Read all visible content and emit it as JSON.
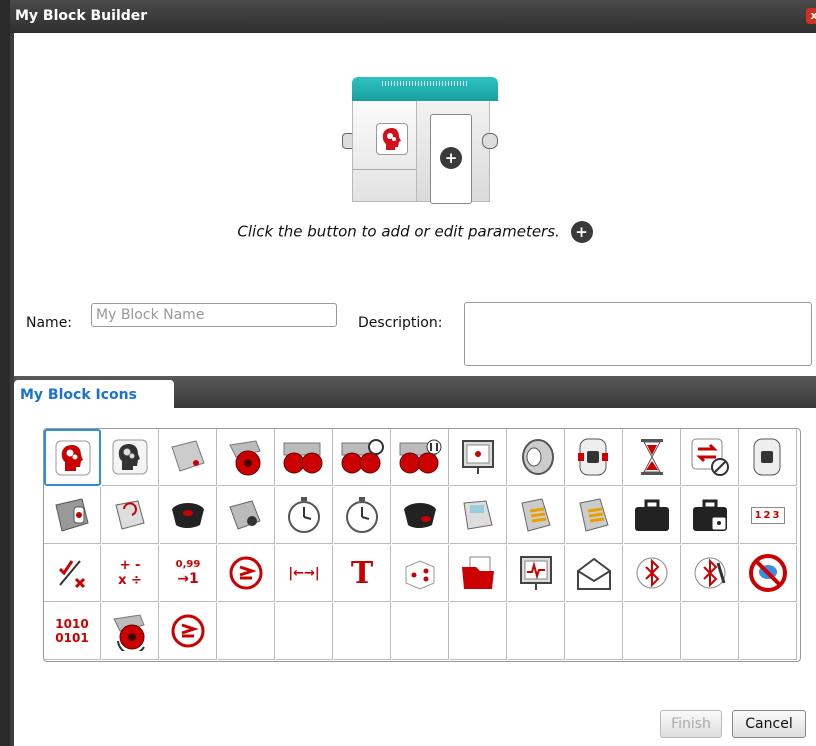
{
  "window": {
    "title": "My Block Builder",
    "close_glyph": "x"
  },
  "block_preview": {
    "add_glyph": "+"
  },
  "instruction": "Click the button to add or edit parameters.",
  "name_field": {
    "label": "Name:",
    "placeholder": "My Block Name",
    "value": ""
  },
  "description_field": {
    "label": "Description:",
    "value": ""
  },
  "tabs": [
    {
      "label": "My Block Icons",
      "selected": true
    }
  ],
  "icons": [
    {
      "name": "brain-gears-red-icon"
    },
    {
      "name": "brain-gears-gray-icon"
    },
    {
      "name": "medium-motor-icon"
    },
    {
      "name": "large-motor-icon"
    },
    {
      "name": "move-steering-pair-icon"
    },
    {
      "name": "move-steering-wheel-icon"
    },
    {
      "name": "move-tank-icon"
    },
    {
      "name": "display-icon"
    },
    {
      "name": "sound-speaker-icon"
    },
    {
      "name": "brick-status-light-icon"
    },
    {
      "name": "wait-hourglass-icon"
    },
    {
      "name": "loop-interrupt-icon"
    },
    {
      "name": "brick-buttons-icon"
    },
    {
      "name": "color-sensor-icon"
    },
    {
      "name": "gyro-sensor-icon"
    },
    {
      "name": "infrared-sensor-icon"
    },
    {
      "name": "motor-rotation-icon"
    },
    {
      "name": "touch-sensor-icon"
    },
    {
      "name": "timer-icon"
    },
    {
      "name": "ultrasonic-sensor-icon"
    },
    {
      "name": "ir-beacon-icon"
    },
    {
      "name": "energy-meter-icon"
    },
    {
      "name": "temperature-sensor-icon"
    },
    {
      "name": "suitcase-icon"
    },
    {
      "name": "suitcase-lock-icon"
    },
    {
      "name": "numbers-123-icon"
    },
    {
      "name": "logic-check-cross-icon"
    },
    {
      "name": "math-operators-icon"
    },
    {
      "name": "round-number-icon"
    },
    {
      "name": "compare-icon"
    },
    {
      "name": "range-icon"
    },
    {
      "name": "text-icon"
    },
    {
      "name": "random-dice-icon"
    },
    {
      "name": "file-access-icon"
    },
    {
      "name": "data-logging-icon"
    },
    {
      "name": "messaging-envelope-icon"
    },
    {
      "name": "bluetooth-icon"
    },
    {
      "name": "bluetooth-off-icon"
    },
    {
      "name": "no-messaging-icon"
    },
    {
      "name": "binary-1010-0101-icon"
    },
    {
      "name": "motor-rotation-reset-icon"
    },
    {
      "name": "compare-small-icon"
    }
  ],
  "icon_texts": {
    "numbers": "123",
    "math_top": "+ -",
    "math_bottom": "x ÷",
    "round_top": "0,99",
    "round_bottom": "→1",
    "range": "|←→|",
    "text": "T",
    "binary_top": "1010",
    "binary_bottom": "0101"
  },
  "buttons": {
    "finish": "Finish",
    "cancel": "Cancel"
  },
  "colors": {
    "accent_teal": "#18a0a0",
    "tab_blue": "#1a73d0",
    "icon_red": "#cc0000"
  }
}
